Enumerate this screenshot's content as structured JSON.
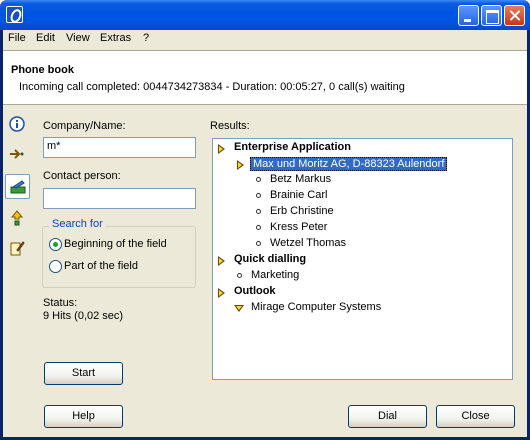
{
  "menu": {
    "file": "File",
    "edit": "Edit",
    "view": "View",
    "extras": "Extras",
    "help": "?"
  },
  "header": {
    "title": "Phone book",
    "status": "Incoming call completed: 0044734273834 - Duration: 00:05:27, 0 call(s) waiting"
  },
  "form": {
    "company_label": "Company/Name:",
    "company_value": "m*",
    "contact_label": "Contact person:",
    "contact_value": "",
    "search_for_label": "Search for",
    "option_beginning": "Beginning of the field",
    "option_part": "Part of the field",
    "selected_option": "Beginning of the field",
    "status_label": "Status:",
    "status_value": "9 Hits (0,02 sec)"
  },
  "results": {
    "label": "Results:",
    "tree": [
      {
        "text": "Enterprise Application",
        "group": true,
        "expanded": true
      },
      {
        "text": "Max und Moritz AG, D-88323 Aulendorf",
        "selected": true
      },
      {
        "text": "Betz Markus"
      },
      {
        "text": "Brainie Carl"
      },
      {
        "text": "Erb Christine"
      },
      {
        "text": "Kress Peter"
      },
      {
        "text": "Wetzel Thomas"
      },
      {
        "text": "Quick dialling",
        "group": true
      },
      {
        "text": "Marketing"
      },
      {
        "text": "Outlook",
        "group": true
      },
      {
        "text": "Mirage Computer Systems"
      }
    ]
  },
  "buttons": {
    "start": "Start",
    "help": "Help",
    "dial": "Dial",
    "close": "Close"
  },
  "side_toolbar": [
    "info-icon",
    "call-forward-icon",
    "phonebook-icon",
    "transfer-icon",
    "notes-icon"
  ],
  "colors": {
    "title_bar": "#0054e3",
    "selection": "#316ac5",
    "group_legend": "#0046d5",
    "radio_dot": "#21a121"
  }
}
